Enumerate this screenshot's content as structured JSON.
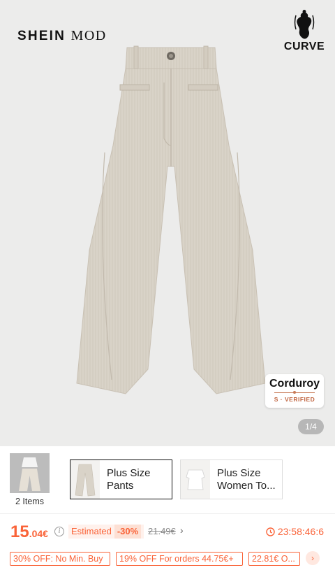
{
  "hero": {
    "brand_bold": "SHEIN",
    "brand_light": "MOD",
    "curve_label": "CURVE",
    "badge_title": "Corduroy",
    "badge_sub": "S · VERIFIED",
    "pager": "1/4",
    "product_color": "#d9d3c8"
  },
  "variants": {
    "set_label": "2 Items",
    "items": [
      {
        "label": "Plus Size Pants",
        "selected": true
      },
      {
        "label": "Plus Size Women To...",
        "selected": false
      }
    ]
  },
  "price": {
    "int": "15",
    "dec": ".04€",
    "info_icon": "info-icon",
    "estimated_label": "Estimated",
    "discount": "-30%",
    "original": "21.49€",
    "timer": "23:58:46:6",
    "accent_color": "#fa6338"
  },
  "coupons": [
    "30% OFF: No Min. Buy",
    "19% OFF For orders 44.75€+",
    "22.81€ O..."
  ]
}
